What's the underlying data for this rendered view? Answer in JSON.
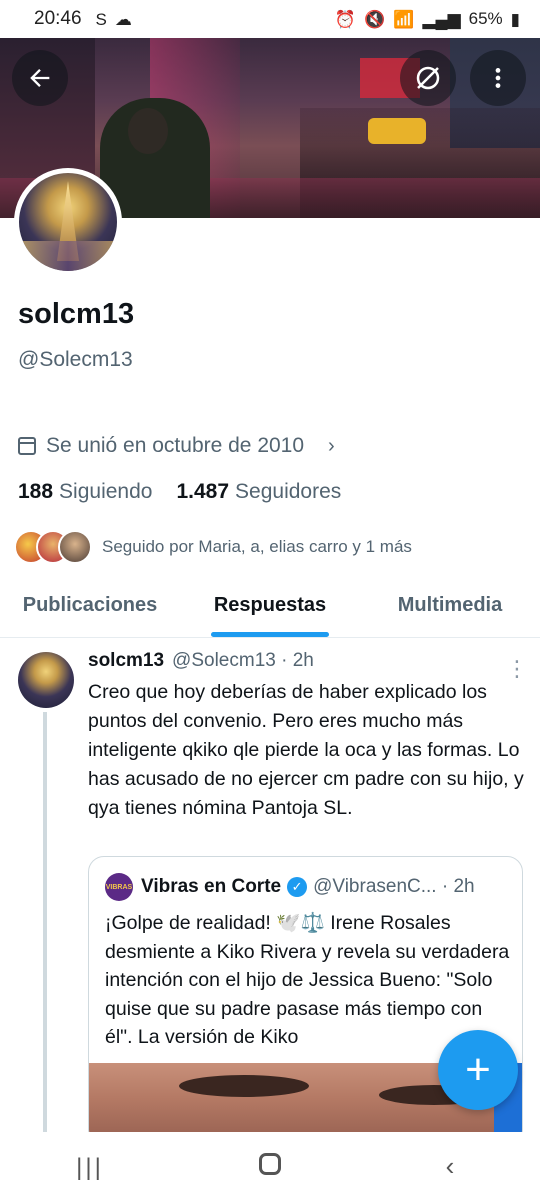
{
  "status_bar": {
    "time": "20:46",
    "battery": "65%"
  },
  "profile": {
    "display_name": "solcm13",
    "handle": "@Solecm13",
    "joined": "Se unió en octubre de 2010",
    "following_count": "188",
    "following_label": "Siguiendo",
    "followers_count": "1.487",
    "followers_label": "Seguidores",
    "followed_by": "Seguido por Maria, a, elias carro y 1 más"
  },
  "tabs": [
    {
      "label": "Publicaciones",
      "active": false
    },
    {
      "label": "Respuestas",
      "active": true
    },
    {
      "label": "Multimedia",
      "active": false
    }
  ],
  "post": {
    "name": "solcm13",
    "meta": "@Solecm13 · 2h",
    "text": "Creo que hoy deberías de haber explicado los puntos del convenio. Pero eres mucho más inteligente qkiko qle pierde la oca y las formas. Lo has acusado de no ejercer cm padre con su hijo, y qya tienes nómina Pantoja SL.",
    "quote": {
      "logo_text": "VIBRAS",
      "name": "Vibras en Corte",
      "meta": "@VibrasenC... · 2h",
      "text": "¡Golpe de realidad! 🕊️⚖️ Irene Rosales desmiente a Kiko Rivera y revela su verdadera intención con el hijo de Jessica Bueno: \"Solo quise que su padre pasase más tiempo con él\". La versión de Kiko"
    }
  },
  "colors": {
    "accent": "#1d9bf0",
    "text_primary": "#0f1419",
    "text_secondary": "#536471"
  },
  "icons": {
    "back": "arrow-left-icon",
    "sync": "slashed-circle-icon",
    "more": "vertical-ellipsis-icon",
    "compose": "plus-icon",
    "calendar": "calendar-icon"
  }
}
